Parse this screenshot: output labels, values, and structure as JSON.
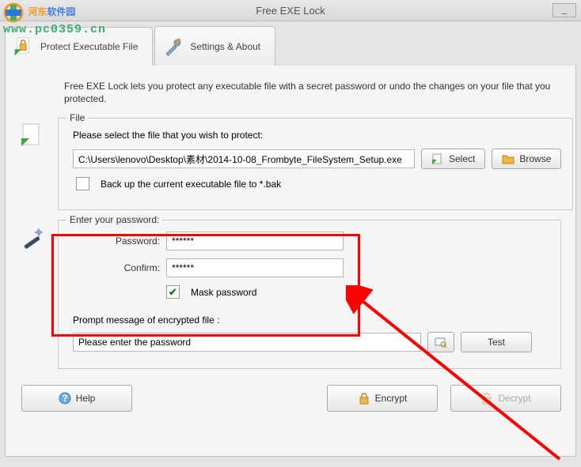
{
  "window": {
    "title": "Free EXE Lock",
    "min_label": "_"
  },
  "watermark": {
    "line1a": "河东",
    "line1b": "软件园",
    "line2": "www.pc0359.cn"
  },
  "tabs": {
    "protect": "Protect Executable File",
    "settings": "Settings & About"
  },
  "description": "Free EXE Lock lets you protect any executable file with a secret password or undo the changes on your file that you protected.",
  "file": {
    "legend": "File",
    "instruction": "Please select the file that you wish to protect:",
    "path": "C:\\Users\\lenovo\\Desktop\\素材\\2014-10-08_Frombyte_FileSystem_Setup.exe",
    "select_label": "Select",
    "browse_label": "Browse",
    "backup_label": "Back up the current executable file to *.bak"
  },
  "password": {
    "legend": "Enter your password:",
    "pwd_label": "Password:",
    "pwd_value": "******",
    "confirm_label": "Confirm:",
    "confirm_value": "******",
    "mask_label": "Mask password"
  },
  "prompt": {
    "label": "Prompt message of encrypted file :",
    "value": "Please enter the password",
    "test_label": "Test"
  },
  "buttons": {
    "help": "Help",
    "encrypt": "Encrypt",
    "decrypt": "Decrypt"
  }
}
